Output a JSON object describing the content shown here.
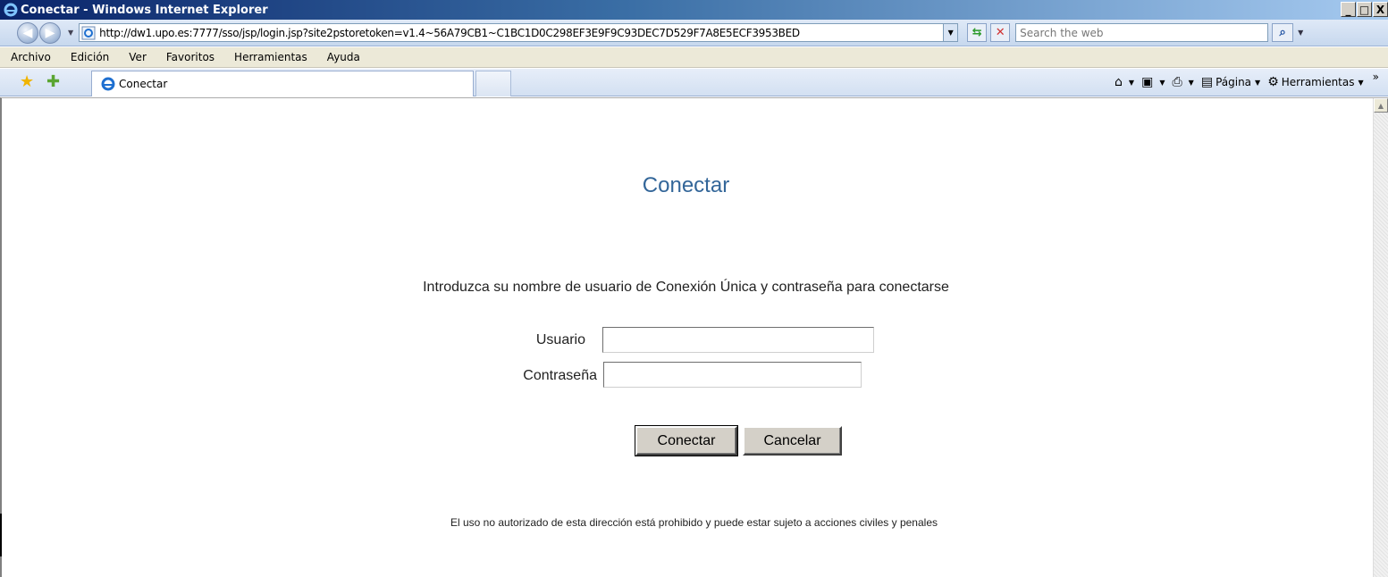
{
  "window": {
    "title": "Conectar - Windows Internet Explorer",
    "controls": {
      "minimize": "_",
      "maximize": "□",
      "close": "X"
    }
  },
  "address_bar": {
    "url": "http://dw1.upo.es:7777/sso/jsp/login.jsp?site2pstoretoken=v1.4~56A79CB1~C1BC1D0C298EF3E9F9C93DEC7D529F7A8E5ECF3953BED",
    "search_placeholder": "Search the web"
  },
  "menu": {
    "items": [
      "Archivo",
      "Edición",
      "Ver",
      "Favoritos",
      "Herramientas",
      "Ayuda"
    ]
  },
  "tabs": {
    "active_label": "Conectar"
  },
  "command_bar": {
    "page_label": "Página",
    "tools_label": "Herramientas"
  },
  "login": {
    "heading": "Conectar",
    "instructions": "Introduzca su nombre de usuario de Conexión Única y contraseña para conectarse",
    "username_label": "Usuario",
    "username_value": "",
    "password_label": "Contraseña",
    "password_value": "",
    "connect_label": "Conectar",
    "cancel_label": "Cancelar",
    "footer": "El uso no autorizado de esta dirección está prohibido y puede estar sujeto a acciones civiles y penales"
  },
  "colors": {
    "heading": "#336699",
    "titlebar_start": "#0a246a",
    "button_face": "#d4d0c8"
  },
  "icons": [
    "ie-logo-icon",
    "back-arrow-icon",
    "forward-arrow-icon",
    "refresh-icon",
    "stop-icon",
    "search-icon",
    "favorites-star-icon",
    "add-favorites-icon",
    "home-icon",
    "feeds-icon",
    "print-icon",
    "page-icon",
    "gear-icon"
  ]
}
